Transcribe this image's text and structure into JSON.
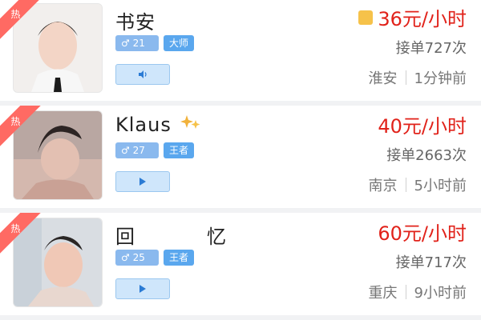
{
  "companions": [
    {
      "name": "书安",
      "gender_age": "♂ 21",
      "rank": "大师",
      "price": "36元/小时",
      "orders": "接单727次",
      "city": "淮安",
      "time": "1分钟前",
      "hot_label": "热",
      "has_price_icon": true,
      "media_button_icon": "volume-icon"
    },
    {
      "name": "Klaus",
      "gender_age": "♂ 27",
      "rank": "王者",
      "price": "40元/小时",
      "orders": "接单2663次",
      "city": "南京",
      "time": "5小时前",
      "hot_label": "热",
      "has_price_icon": false,
      "media_button_icon": "play-icon"
    },
    {
      "name": "回忆",
      "gender_age": "♂ 25",
      "rank": "王者",
      "price": "60元/小时",
      "orders": "接单717次",
      "city": "重庆",
      "time": "9小时前",
      "hot_label": "热",
      "has_price_icon": false,
      "media_button_icon": "play-icon"
    }
  ],
  "colors": {
    "price": "#e1221a",
    "badge_gender": "#8ab9ee",
    "badge_rank": "#5aa7ee",
    "hot_ribbon": "#ff6a63",
    "separator": "#f1f2f4"
  }
}
